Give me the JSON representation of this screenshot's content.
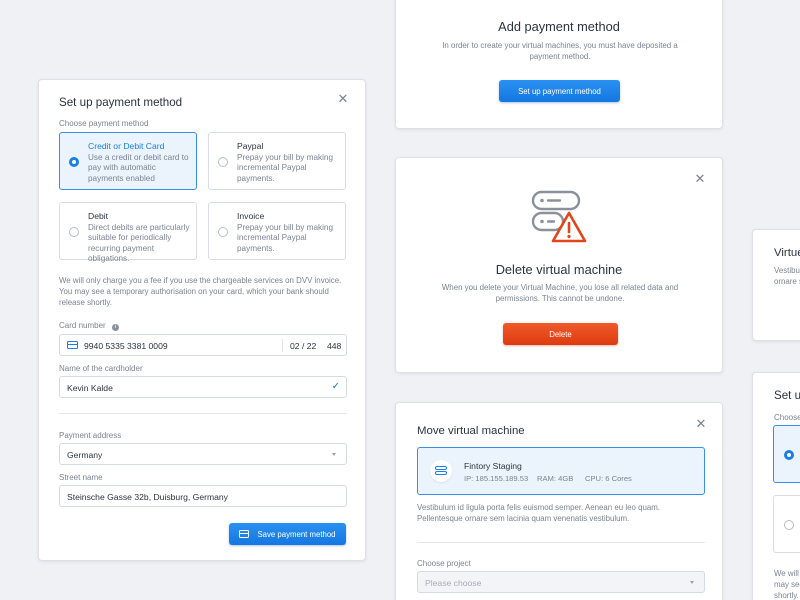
{
  "setup_modal": {
    "title": "Set up payment method",
    "choose_label": "Choose payment method",
    "options": [
      {
        "title": "Credit or Debit Card",
        "desc": "Use a credit or debit card to pay with automatic payments enabled",
        "selected": true
      },
      {
        "title": "Paypal",
        "desc": "Prepay your bill by making incremental Paypal payments.",
        "selected": false
      },
      {
        "title": "Debit",
        "desc": "Direct debits are particularly suitable for periodically recurring payment obligations.",
        "selected": false
      },
      {
        "title": "Invoice",
        "desc": "Prepay your bill by making incremental Paypal payments.",
        "selected": false
      }
    ],
    "notice": "We will only charge you a fee if you use the chargeable services on DVV invoice. You may see a temporary authorisation on your card, which your bank should release shortly.",
    "card_number_label": "Card number",
    "card_number": "9940 5335 3381 0009",
    "card_expiry": "02 / 22",
    "card_cvc": "448",
    "cardholder_label": "Name of the cardholder",
    "cardholder": "Kevin Kalde",
    "address_label": "Payment address",
    "address_country": "Germany",
    "street_label": "Street name",
    "street": "Steinsche Gasse 32b, Duisburg, Germany",
    "save_button": "Save payment method"
  },
  "add_modal": {
    "title": "Add payment method",
    "desc": "In order to create your virtual machines, you must have deposited a payment method.",
    "button": "Set up payment method"
  },
  "delete_modal": {
    "title": "Delete virtual machine",
    "desc": "When you delete your Virtual Machine, you lose all related data and permissions. This cannot be undone.",
    "button": "Delete"
  },
  "move_modal": {
    "title": "Move virtual machine",
    "vm_name": "Fintory Staging",
    "vm_ip": "IP:  185.155.189.53",
    "vm_ram": "RAM:  4GB",
    "vm_cpu": "CPU:  6 Cores",
    "desc": "Vestibulum id ligula porta felis euismod semper. Aenean eu leo quam. Pellentesque ornare sem lacinia quam venenatis vestibulum.",
    "project_label": "Choose project",
    "project_placeholder": "Please choose"
  },
  "right_partial_1": {
    "title": "Virtue",
    "line1": "Vestibul",
    "line2": "ornare s"
  },
  "right_partial_2": {
    "title": "Set up",
    "choose": "Choose",
    "line1": "We will o",
    "line2": "may see",
    "line3": "shortly."
  },
  "colors": {
    "accent": "#1a7ee6",
    "danger": "#e1461a",
    "background": "#f0f1f5"
  }
}
